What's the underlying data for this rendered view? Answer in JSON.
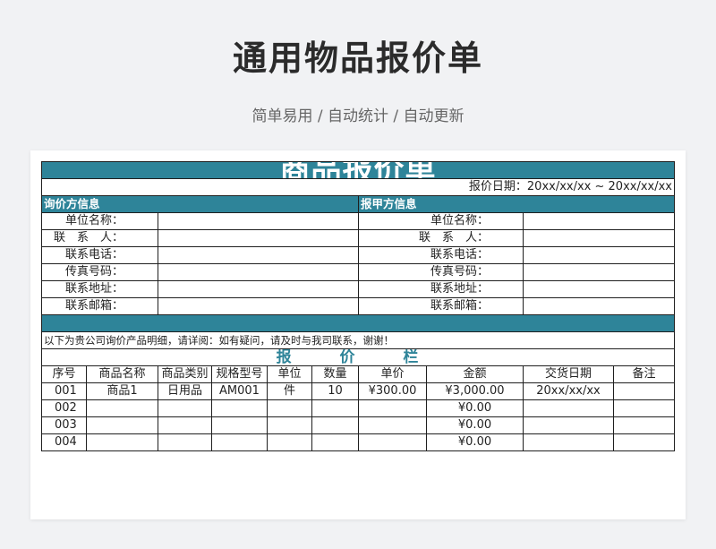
{
  "page": {
    "title": "通用物品报价单",
    "subtitle": "简单易用 / 自动统计 / 自动更新"
  },
  "sheet": {
    "banner_title": "商品报价单",
    "quote_date": "报价日期：20xx/xx/xx ~ 20xx/xx/xx",
    "inquirer_header": "询价方信息",
    "quoter_header": "报甲方信息",
    "info_labels": [
      "单位名称：",
      "联　系　人：",
      "联系电话：",
      "传真号码：",
      "联系地址：",
      "联系邮箱："
    ],
    "notice": "以下为贵公司询价产品明细，请详阅：如有疑问，请及时与我司联系，谢谢！",
    "section_title": "报 价 栏",
    "columns": [
      "序号",
      "商品名称",
      "商品类别",
      "规格型号",
      "单位",
      "数量",
      "单价",
      "金额",
      "交货日期",
      "备注"
    ],
    "rows": [
      [
        "001",
        "商品1",
        "日用品",
        "AM001",
        "件",
        "10",
        "¥300.00",
        "¥3,000.00",
        "20xx/xx/xx",
        ""
      ],
      [
        "002",
        "",
        "",
        "",
        "",
        "",
        "",
        "¥0.00",
        "",
        ""
      ],
      [
        "003",
        "",
        "",
        "",
        "",
        "",
        "",
        "¥0.00",
        "",
        ""
      ],
      [
        "004",
        "",
        "",
        "",
        "",
        "",
        "",
        "¥0.00",
        "",
        ""
      ]
    ]
  },
  "colors": {
    "accent": "#2e8499",
    "background": "#f1f2f4"
  }
}
